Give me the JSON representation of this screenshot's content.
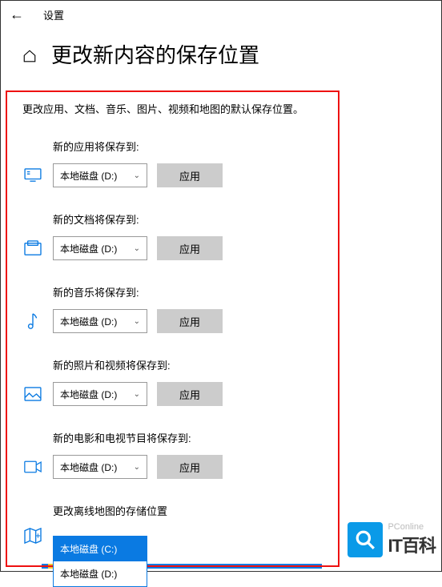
{
  "topbar": {
    "settings": "设置"
  },
  "header": {
    "title": "更改新内容的保存位置"
  },
  "description": "更改应用、文档、音乐、图片、视频和地图的默认保存位置。",
  "apply_label": "应用",
  "groups": [
    {
      "label": "新的应用将保存到:",
      "value": "本地磁盘 (D:)"
    },
    {
      "label": "新的文档将保存到:",
      "value": "本地磁盘 (D:)"
    },
    {
      "label": "新的音乐将保存到:",
      "value": "本地磁盘 (D:)"
    },
    {
      "label": "新的照片和视频将保存到:",
      "value": "本地磁盘 (D:)"
    },
    {
      "label": "新的电影和电视节目将保存到:",
      "value": "本地磁盘 (D:)"
    },
    {
      "label": "更改离线地图的存储位置"
    }
  ],
  "dropdown_options": [
    "本地磁盘 (C:)",
    "本地磁盘 (D:)"
  ],
  "watermark": {
    "brand": "PConline",
    "title": "IT百科"
  }
}
